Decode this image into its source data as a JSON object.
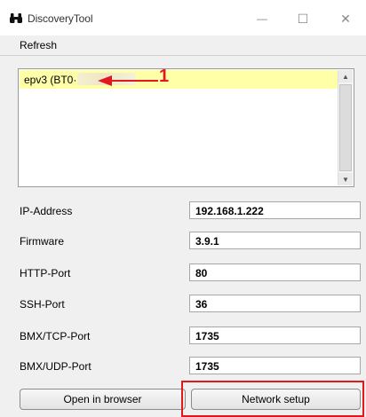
{
  "window": {
    "title": "DiscoveryTool",
    "minimize_glyph": "—",
    "maximize_glyph": "☐",
    "close_glyph": "✕"
  },
  "menu": {
    "refresh_label": "Refresh"
  },
  "devices": {
    "items": [
      {
        "label": "epv3 (BT0·"
      }
    ],
    "selected_index": 0
  },
  "annotation": {
    "number": "1",
    "color": "#e0191e"
  },
  "fields": [
    {
      "label": "IP-Address",
      "value": "192.168.1.222"
    },
    {
      "label": "Firmware",
      "value": "3.9.1"
    },
    {
      "label": "HTTP-Port",
      "value": "80"
    },
    {
      "label": "SSH-Port",
      "value": "36"
    },
    {
      "label": "BMX/TCP-Port",
      "value": "1735"
    },
    {
      "label": "BMX/UDP-Port",
      "value": "1735"
    }
  ],
  "buttons": {
    "open_browser_label": "Open in browser",
    "network_setup_label": "Network setup"
  },
  "colors": {
    "selection_bg": "#ffffa8",
    "highlight_border": "#e0191e"
  }
}
